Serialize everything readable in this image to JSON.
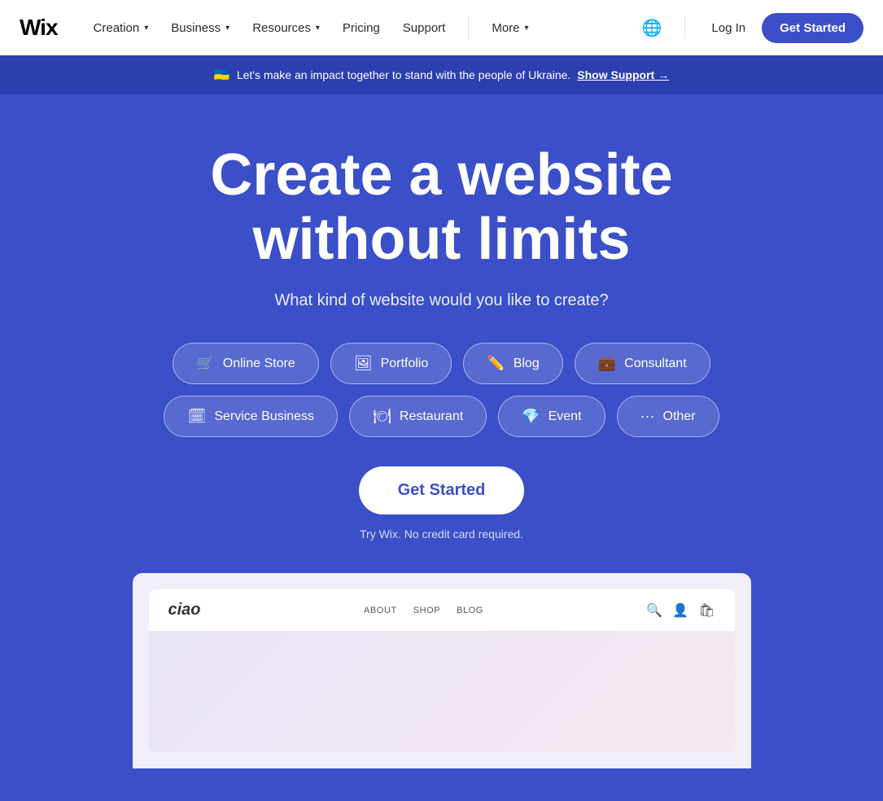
{
  "navbar": {
    "logo": "Wix",
    "nav_items": [
      {
        "label": "Creation",
        "has_dropdown": true
      },
      {
        "label": "Business",
        "has_dropdown": true
      },
      {
        "label": "Resources",
        "has_dropdown": true
      },
      {
        "label": "Pricing",
        "has_dropdown": false
      },
      {
        "label": "Support",
        "has_dropdown": false
      },
      {
        "label": "More",
        "has_dropdown": true
      }
    ],
    "login_label": "Log In",
    "get_started_label": "Get Started"
  },
  "banner": {
    "flag": "🇺🇦",
    "text": "Let's make an impact together to stand with the people of Ukraine.",
    "link_text": "Show Support",
    "arrow": "→"
  },
  "hero": {
    "title_line1": "Create a website",
    "title_line2": "without limits",
    "subtitle": "What kind of website would you like to create?",
    "website_types_row1": [
      {
        "label": "Online Store",
        "icon": "🛒"
      },
      {
        "label": "Portfolio",
        "icon": "🖼"
      },
      {
        "label": "Blog",
        "icon": "✏️"
      },
      {
        "label": "Consultant",
        "icon": "💼"
      }
    ],
    "website_types_row2": [
      {
        "label": "Service Business",
        "icon": "🗓"
      },
      {
        "label": "Restaurant",
        "icon": "🍽"
      },
      {
        "label": "Event",
        "icon": "💎"
      },
      {
        "label": "Other",
        "icon": "···"
      }
    ],
    "cta_label": "Get Started",
    "no_credit_text": "Try Wix. No credit card required."
  },
  "preview": {
    "logo": "ciao",
    "nav_links": [
      "ABOUT",
      "SHOP",
      "BLOG"
    ],
    "icons": [
      "🔍",
      "👤",
      "🛍"
    ]
  }
}
